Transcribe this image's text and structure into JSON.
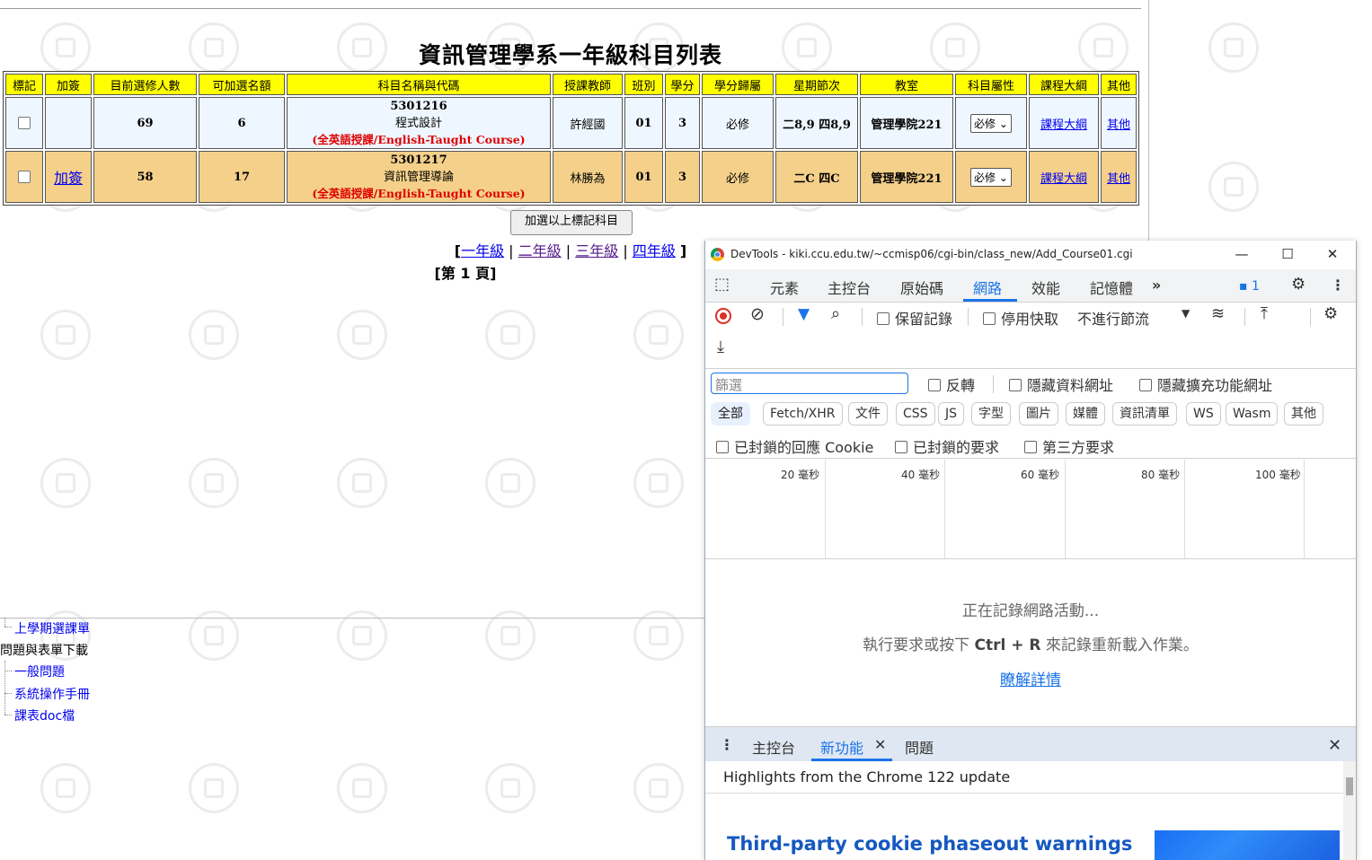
{
  "page": {
    "title": "資訊管理學系一年級科目列表",
    "headers": [
      "標記",
      "加簽",
      "目前選修人數",
      "可加選名額",
      "科目名稱與代碼",
      "授課教師",
      "班別",
      "學分",
      "學分歸屬",
      "星期節次",
      "教室",
      "科目屬性",
      "課程大綱",
      "其他"
    ],
    "rows": [
      {
        "add_link": "",
        "enrolled": "69",
        "quota": "6",
        "code": "5301216",
        "name": "程式設計",
        "eng": "(全英語授課/English-Taught Course)",
        "teacher": "許經國",
        "class": "01",
        "credit": "3",
        "belong": "必修",
        "time": "二8,9 四8,9",
        "room": "管理學院221",
        "attr": "必修",
        "syllabus": "課程大綱",
        "other": "其他"
      },
      {
        "add_link": "加簽",
        "enrolled": "58",
        "quota": "17",
        "code": "5301217",
        "name": "資訊管理導論",
        "eng": "(全英語授課/English-Taught Course)",
        "teacher": "林勝為",
        "class": "01",
        "credit": "3",
        "belong": "必修",
        "time": "二C 四C",
        "room": "管理學院221",
        "attr": "必修",
        "syllabus": "課程大綱",
        "other": "其他"
      }
    ],
    "submit_label": "加選以上標記科目",
    "grades": [
      "一年級",
      "二年級",
      "三年級",
      "四年級"
    ],
    "page_num": "[第 1 頁]"
  },
  "tree": {
    "item1": "上學期選課單",
    "section": "問題與表單下載",
    "item2": "一般問題",
    "item3": "系統操作手冊",
    "item4": "課表doc檔"
  },
  "devtools": {
    "title": "DevTools - kiki.ccu.edu.tw/~ccmisp06/cgi-bin/class_new/Add_Course01.cgi",
    "tabs": [
      "元素",
      "主控台",
      "原始碼",
      "網路",
      "效能",
      "記憶體"
    ],
    "issues_count": "1",
    "preserve_log": "保留記錄",
    "disable_cache": "停用快取",
    "throttle": "不進行節流",
    "filter_placeholder": "篩選",
    "invert": "反轉",
    "hide_data": "隱藏資料網址",
    "hide_ext": "隱藏擴充功能網址",
    "types": [
      "全部",
      "Fetch/XHR",
      "文件",
      "CSS",
      "JS",
      "字型",
      "圖片",
      "媒體",
      "資訊清單",
      "WS",
      "Wasm",
      "其他"
    ],
    "blocked_cookies": "已封鎖的回應 Cookie",
    "blocked_requests": "已封鎖的要求",
    "third_party": "第三方要求",
    "timeline_labels": [
      "20 毫秒",
      "40 毫秒",
      "60 毫秒",
      "80 毫秒",
      "100 毫秒"
    ],
    "recording": "正在記錄網路活動...",
    "hint_pre": "執行要求或按下 ",
    "hint_key": "Ctrl + R",
    "hint_post": " 來記錄重新載入作業。",
    "learn_more": "瞭解詳情",
    "drawer_tabs": [
      "主控台",
      "新功能",
      "問題"
    ],
    "whats_new_head": "Highlights from the Chrome 122 update",
    "whats_new_title": "Third-party cookie phaseout warnings"
  }
}
